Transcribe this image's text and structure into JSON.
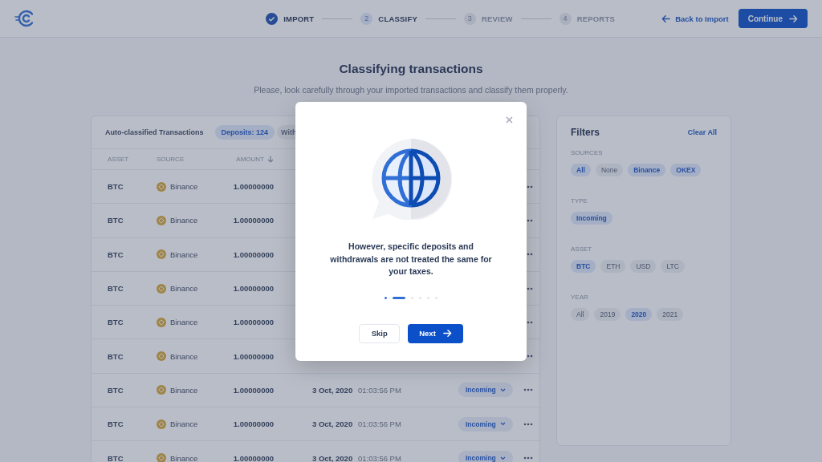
{
  "header": {
    "steps": [
      {
        "label": "IMPORT",
        "completed": true,
        "selected": false
      },
      {
        "number": "2",
        "label": "CLASSIFY",
        "completed": false,
        "selected": true
      },
      {
        "number": "3",
        "label": "REVIEW",
        "completed": false,
        "selected": false
      },
      {
        "number": "4",
        "label": "REPORTS",
        "completed": false,
        "selected": false
      }
    ],
    "back_link": "Back to Import",
    "continue_button": "Continue"
  },
  "page": {
    "title": "Classifying transactions",
    "subtitle": "Please, look carefully through your imported transactions and classify them properly."
  },
  "table": {
    "title": "Auto-classified Transactions",
    "tabs": [
      {
        "label": "Deposits: 124",
        "selected": true
      },
      {
        "label": "With",
        "selected": false
      }
    ],
    "columns": [
      "ASSET",
      "SOURCE",
      "AMOUNT"
    ],
    "rows": [
      {
        "asset": "BTC",
        "source": "Binance",
        "amount": "1.00000000"
      },
      {
        "asset": "BTC",
        "source": "Binance",
        "amount": "1.00000000"
      },
      {
        "asset": "BTC",
        "source": "Binance",
        "amount": "1.00000000"
      },
      {
        "asset": "BTC",
        "source": "Binance",
        "amount": "1.00000000"
      },
      {
        "asset": "BTC",
        "source": "Binance",
        "amount": "1.00000000"
      },
      {
        "asset": "BTC",
        "source": "Binance",
        "amount": "1.00000000"
      },
      {
        "asset": "BTC",
        "source": "Binance",
        "amount": "1.00000000",
        "date": "3 Oct, 2020",
        "time": "01:03:56 PM",
        "type": "Incoming"
      },
      {
        "asset": "BTC",
        "source": "Binance",
        "amount": "1.00000000",
        "date": "3 Oct, 2020",
        "time": "01:03:56 PM",
        "type": "Incoming"
      },
      {
        "asset": "BTC",
        "source": "Binance",
        "amount": "1.00000000",
        "date": "3 Oct, 2020",
        "time": "01:03:56 PM",
        "type": "Incoming"
      }
    ]
  },
  "filters": {
    "title": "Filters",
    "clear_all": "Clear All",
    "groups": [
      {
        "label": "SOURCES",
        "options": [
          {
            "label": "All",
            "selected": true
          },
          {
            "label": "None",
            "selected": false
          },
          {
            "label": "Binance",
            "selected": true
          },
          {
            "label": "OKEX",
            "selected": true
          }
        ]
      },
      {
        "label": "TYPE",
        "options": [
          {
            "label": "Incoming",
            "selected": true
          }
        ]
      },
      {
        "label": "ASSET",
        "options": [
          {
            "label": "BTC",
            "selected": true
          },
          {
            "label": "ETH",
            "selected": false
          },
          {
            "label": "USD",
            "selected": false
          },
          {
            "label": "LTC",
            "selected": false
          }
        ]
      },
      {
        "label": "YEAR",
        "options": [
          {
            "label": "All",
            "selected": false
          },
          {
            "label": "2019",
            "selected": false
          },
          {
            "label": "2020",
            "selected": true
          },
          {
            "label": "2021",
            "selected": false
          }
        ]
      }
    ]
  },
  "modal": {
    "message": "However, specific deposits and withdrawals are not treated the same for your taxes.",
    "pager": [
      {
        "selected": false
      },
      {
        "selected": true
      },
      {
        "selected": false
      },
      {
        "selected": false
      },
      {
        "selected": false
      },
      {
        "selected": false
      }
    ],
    "skip_button": "Skip",
    "next_button": "Next"
  }
}
